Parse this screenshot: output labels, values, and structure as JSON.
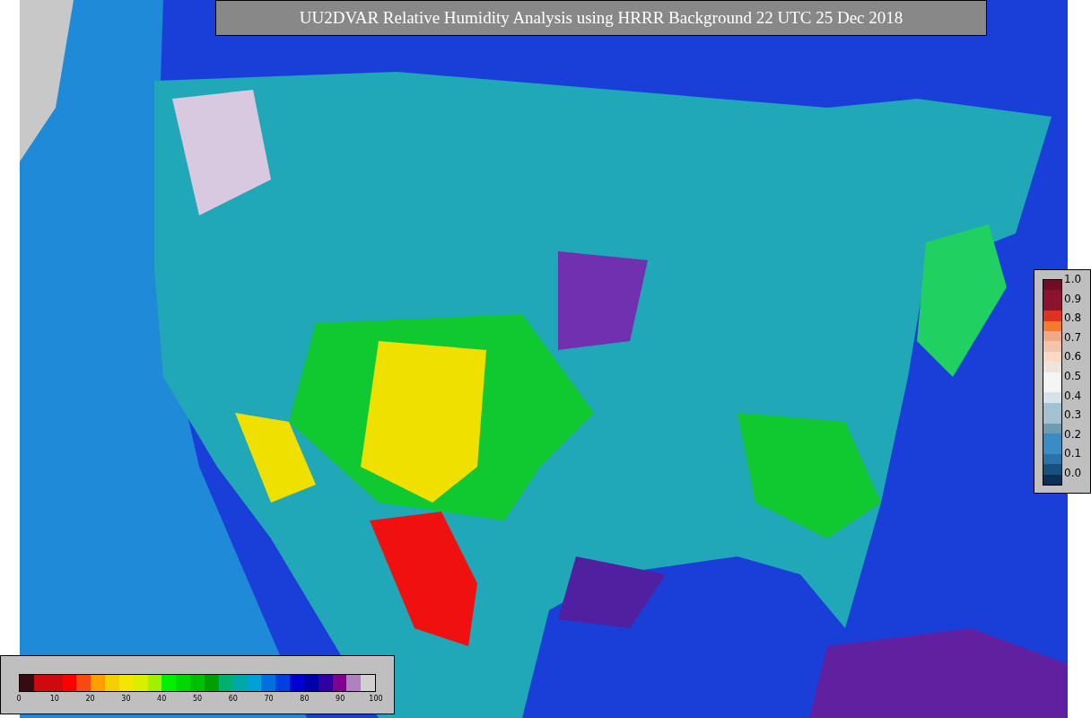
{
  "title": "UU2DVAR Relative Humidity Analysis using HRRR Background 22 UTC 25 Dec 2018",
  "side_colorbar": {
    "ticks": [
      "1.0",
      "0.9",
      "0.8",
      "0.7",
      "0.6",
      "0.5",
      "0.4",
      "0.3",
      "0.2",
      "0.1",
      "0.0"
    ],
    "segments": [
      {
        "color": "#6f0d25"
      },
      {
        "color": "#8b1330"
      },
      {
        "color": "#8b1330"
      },
      {
        "color": "#e0331f"
      },
      {
        "color": "#f27b30"
      },
      {
        "color": "#efa98a"
      },
      {
        "color": "#f2c4ab"
      },
      {
        "color": "#f9d9c6"
      },
      {
        "color": "#eee4de"
      },
      {
        "color": "#f5f5f5"
      },
      {
        "color": "#f5f5f5"
      },
      {
        "color": "#d7e3ea"
      },
      {
        "color": "#a3c1d2"
      },
      {
        "color": "#a3c1d2"
      },
      {
        "color": "#6f9bb2"
      },
      {
        "color": "#3a8cc4"
      },
      {
        "color": "#3a8cc4"
      },
      {
        "color": "#2a73a8"
      },
      {
        "color": "#18507f"
      },
      {
        "color": "#0d2e55"
      }
    ]
  },
  "bottom_colorbar": {
    "ticks": [
      "0",
      "10",
      "20",
      "30",
      "40",
      "50",
      "60",
      "70",
      "80",
      "90",
      "100"
    ],
    "segments": [
      {
        "color": "#3a0a14"
      },
      {
        "color": "#cc0a10"
      },
      {
        "color": "#cc0a10"
      },
      {
        "color": "#ff0000"
      },
      {
        "color": "#f84a10"
      },
      {
        "color": "#ffa000"
      },
      {
        "color": "#f5d000"
      },
      {
        "color": "#f0e800"
      },
      {
        "color": "#d8f000"
      },
      {
        "color": "#a0f000"
      },
      {
        "color": "#00f000"
      },
      {
        "color": "#00d800"
      },
      {
        "color": "#00c000"
      },
      {
        "color": "#00a000"
      },
      {
        "color": "#00b070"
      },
      {
        "color": "#00a8a8"
      },
      {
        "color": "#00a0d8"
      },
      {
        "color": "#0070e0"
      },
      {
        "color": "#0040e0"
      },
      {
        "color": "#0000d0"
      },
      {
        "color": "#0000a8"
      },
      {
        "color": "#3000a0"
      },
      {
        "color": "#800090"
      },
      {
        "color": "#b080c0"
      },
      {
        "color": "#d0d0d0"
      }
    ]
  }
}
